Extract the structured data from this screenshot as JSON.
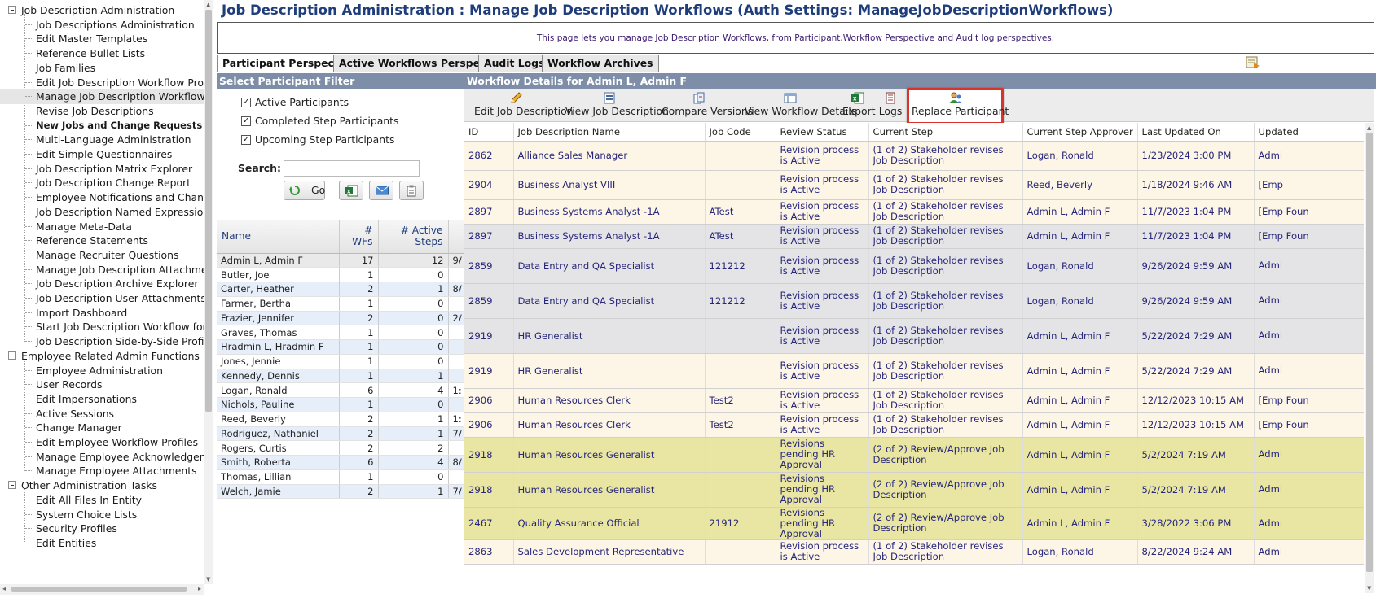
{
  "tree": {
    "groups": [
      {
        "label": "Job Description Administration",
        "items": [
          {
            "label": "Job Descriptions Administration"
          },
          {
            "label": "Edit Master Templates"
          },
          {
            "label": "Reference Bullet Lists"
          },
          {
            "label": "Job Families"
          },
          {
            "label": "Edit Job Description Workflow Prof"
          },
          {
            "label": "Manage Job Description Workflows",
            "selected": true
          },
          {
            "label": "Revise Job Descriptions"
          },
          {
            "label": "New Jobs and Change Requests Admin",
            "bold": true
          },
          {
            "label": "Multi-Language Administration"
          },
          {
            "label": "Edit Simple Questionnaires"
          },
          {
            "label": "Job Description Matrix Explorer"
          },
          {
            "label": "Job Description Change Report"
          },
          {
            "label": "Employee Notifications and Chang"
          },
          {
            "label": "Job Description Named Expression"
          },
          {
            "label": "Manage Meta-Data"
          },
          {
            "label": "Reference Statements"
          },
          {
            "label": "Manage Recruiter Questions"
          },
          {
            "label": "Manage Job Description Attachme"
          },
          {
            "label": "Job Description Archive Explorer"
          },
          {
            "label": "Job Description User Attachments"
          },
          {
            "label": "Import Dashboard"
          },
          {
            "label": "Start Job Description Workflow for"
          },
          {
            "label": "Job Description Side-by-Side Profi"
          }
        ]
      },
      {
        "label": "Employee Related Admin Functions",
        "items": [
          {
            "label": "Employee Administration"
          },
          {
            "label": "User Records"
          },
          {
            "label": "Edit Impersonations"
          },
          {
            "label": "Active Sessions"
          },
          {
            "label": "Change Manager"
          },
          {
            "label": "Edit Employee Workflow Profiles"
          },
          {
            "label": "Manage Employee Acknowledgem"
          },
          {
            "label": "Manage Employee Attachments"
          }
        ]
      },
      {
        "label": "Other Administration Tasks",
        "items": [
          {
            "label": "Edit All Files In Entity"
          },
          {
            "label": "System Choice Lists"
          },
          {
            "label": "Security Profiles"
          },
          {
            "label": "Edit Entities"
          }
        ]
      }
    ]
  },
  "header": {
    "title": "Job Description Administration : Manage Job Description Workflows (Auth Settings: ManageJobDescriptionWorkflows)",
    "info": "This page lets you manage Job Description Workflows, from Participant,Workflow Perspective and Audit log perspectives."
  },
  "tabs": [
    {
      "label": "Participant Perspective",
      "active": true
    },
    {
      "label": "Active Workflows Perspective"
    },
    {
      "label": "Audit Logs"
    },
    {
      "label": "Workflow Archives"
    }
  ],
  "filter": {
    "heading": "Select Participant Filter",
    "checkboxes": [
      {
        "label": "Active Participants",
        "checked": true
      },
      {
        "label": "Completed Step Participants",
        "checked": true
      },
      {
        "label": "Upcoming Step Participants",
        "checked": true
      }
    ],
    "search_label": "Search:",
    "search_value": "",
    "go_label": "Go"
  },
  "participants": {
    "columns": [
      "Name",
      "# WFs",
      "# Active Steps",
      ""
    ],
    "rows": [
      {
        "name": "Admin L, Admin F",
        "wfs": "17",
        "active": "12",
        "extra": "9/",
        "selected": true
      },
      {
        "name": "Butler, Joe",
        "wfs": "1",
        "active": "0",
        "extra": ""
      },
      {
        "name": "Carter, Heather",
        "wfs": "2",
        "active": "1",
        "extra": "8/"
      },
      {
        "name": "Farmer, Bertha",
        "wfs": "1",
        "active": "0",
        "extra": ""
      },
      {
        "name": "Frazier, Jennifer",
        "wfs": "2",
        "active": "0",
        "extra": "2/"
      },
      {
        "name": "Graves, Thomas",
        "wfs": "1",
        "active": "0",
        "extra": ""
      },
      {
        "name": "Hradmin L, Hradmin F",
        "wfs": "1",
        "active": "0",
        "extra": ""
      },
      {
        "name": "Jones, Jennie",
        "wfs": "1",
        "active": "0",
        "extra": ""
      },
      {
        "name": "Kennedy, Dennis",
        "wfs": "1",
        "active": "1",
        "extra": ""
      },
      {
        "name": "Logan, Ronald",
        "wfs": "6",
        "active": "4",
        "extra": "1:"
      },
      {
        "name": "Nichols, Pauline",
        "wfs": "1",
        "active": "0",
        "extra": ""
      },
      {
        "name": "Reed, Beverly",
        "wfs": "2",
        "active": "1",
        "extra": "1:"
      },
      {
        "name": "Rodriguez, Nathaniel",
        "wfs": "2",
        "active": "1",
        "extra": "7/"
      },
      {
        "name": "Rogers, Curtis",
        "wfs": "2",
        "active": "2",
        "extra": ""
      },
      {
        "name": "Smith, Roberta",
        "wfs": "6",
        "active": "4",
        "extra": "8/"
      },
      {
        "name": "Thomas, Lillian",
        "wfs": "1",
        "active": "0",
        "extra": ""
      },
      {
        "name": "Welch, Jamie",
        "wfs": "2",
        "active": "1",
        "extra": "7/"
      }
    ]
  },
  "workflow": {
    "heading": "Workflow Details for Admin L, Admin F",
    "toolbar": [
      {
        "label": "Edit Job Description",
        "icon": "pencil-icon"
      },
      {
        "label": "View Job Description",
        "icon": "document-view-icon"
      },
      {
        "label": "Compare Versions",
        "icon": "compare-icon"
      },
      {
        "label": "View Workflow Details",
        "icon": "workflow-icon"
      },
      {
        "label": "Export",
        "icon": "excel-export-icon"
      },
      {
        "label": "Logs",
        "icon": "logs-icon"
      },
      {
        "label": "Replace Participant",
        "icon": "replace-user-icon",
        "highlighted": true
      }
    ],
    "columns": [
      "ID",
      "Job Description Name",
      "Job Code",
      "Review Status",
      "Current Step",
      "Current Step Approver",
      "Last Updated On",
      "Updated"
    ],
    "rows": [
      {
        "id": "2862",
        "name": "Alliance Sales Manager",
        "code": "",
        "status": "Revision process is Active",
        "step": "(1 of 2) Stakeholder revises Job Description",
        "approver": "Logan, Ronald",
        "updated_on": "1/23/2024 3:00 PM",
        "updated_by": "Admi",
        "color": "cream"
      },
      {
        "id": "2904",
        "name": "Business Analyst VIII",
        "code": "",
        "status": "Revision process is Active",
        "step": "(1 of 2) Stakeholder revises Job Description",
        "approver": "Reed, Beverly",
        "updated_on": "1/18/2024 9:46 AM",
        "updated_by": "[Emp",
        "color": "cream"
      },
      {
        "id": "2897",
        "name": "Business Systems Analyst -1A",
        "code": "ATest",
        "status": "Revision process is Active",
        "step": "(1 of 2) Stakeholder revises Job Description",
        "approver": "Admin L, Admin F",
        "updated_on": "11/7/2023 1:04 PM",
        "updated_by": "[Emp Foun",
        "color": "cream"
      },
      {
        "id": "2897",
        "name": "Business Systems Analyst -1A",
        "code": "ATest",
        "status": "Revision process is Active",
        "step": "(1 of 2) Stakeholder revises Job Description",
        "approver": "Admin L, Admin F",
        "updated_on": "11/7/2023 1:04 PM",
        "updated_by": "[Emp Foun",
        "color": "grey"
      },
      {
        "id": "2859",
        "name": "Data Entry and QA Specialist",
        "code": "121212",
        "status": "Revision process is Active",
        "step": "(1 of 2) Stakeholder revises Job Description",
        "approver": "Logan, Ronald",
        "updated_on": "9/26/2024 9:59 AM",
        "updated_by": "Admi",
        "color": "grey"
      },
      {
        "id": "2859",
        "name": "Data Entry and QA Specialist",
        "code": "121212",
        "status": "Revision process is Active",
        "step": "(1 of 2) Stakeholder revises Job Description",
        "approver": "Logan, Ronald",
        "updated_on": "9/26/2024 9:59 AM",
        "updated_by": "Admi",
        "color": "grey"
      },
      {
        "id": "2919",
        "name": "HR Generalist",
        "code": "",
        "status": "Revision process is Active",
        "step": "(1 of 2) Stakeholder revises Job Description",
        "approver": "Admin L, Admin F",
        "updated_on": "5/22/2024 7:29 AM",
        "updated_by": "Admi",
        "color": "grey"
      },
      {
        "id": "2919",
        "name": "HR Generalist",
        "code": "",
        "status": "Revision process is Active",
        "step": "(1 of 2) Stakeholder revises Job Description",
        "approver": "Admin L, Admin F",
        "updated_on": "5/22/2024 7:29 AM",
        "updated_by": "Admi",
        "color": "cream"
      },
      {
        "id": "2906",
        "name": "Human Resources Clerk",
        "code": "Test2",
        "status": "Revision process is Active",
        "step": "(1 of 2) Stakeholder revises Job Description",
        "approver": "Admin L, Admin F",
        "updated_on": "12/12/2023 10:15 AM",
        "updated_by": "[Emp Foun",
        "color": "cream"
      },
      {
        "id": "2906",
        "name": "Human Resources Clerk",
        "code": "Test2",
        "status": "Revision process is Active",
        "step": "(1 of 2) Stakeholder revises Job Description",
        "approver": "Admin L, Admin F",
        "updated_on": "12/12/2023 10:15 AM",
        "updated_by": "[Emp Foun",
        "color": "cream"
      },
      {
        "id": "2918",
        "name": "Human Resources Generalist",
        "code": "",
        "status": "Revisions pending HR Approval",
        "step": "(2 of 2) Review/Approve Job Description",
        "approver": "Admin L, Admin F",
        "updated_on": "5/2/2024 7:19 AM",
        "updated_by": "Admi",
        "color": "olive"
      },
      {
        "id": "2918",
        "name": "Human Resources Generalist",
        "code": "",
        "status": "Revisions pending HR Approval",
        "step": "(2 of 2) Review/Approve Job Description",
        "approver": "Admin L, Admin F",
        "updated_on": "5/2/2024 7:19 AM",
        "updated_by": "Admi",
        "color": "olive"
      },
      {
        "id": "2467",
        "name": "Quality Assurance Official",
        "code": "21912",
        "status": "Revisions pending HR Approval",
        "step": "(2 of 2) Review/Approve Job Description",
        "approver": "Admin L, Admin F",
        "updated_on": "3/28/2022 3:06 PM",
        "updated_by": "Admi",
        "color": "olive"
      },
      {
        "id": "2863",
        "name": "Sales Development Representative",
        "code": "",
        "status": "Revision process is Active",
        "step": "(1 of 2) Stakeholder revises Job Description",
        "approver": "Logan, Ronald",
        "updated_on": "8/22/2024 9:24 AM",
        "updated_by": "Admi",
        "color": "cream"
      }
    ]
  },
  "colors": {
    "title": "#1f3d7a",
    "panel_header": "#7e8ea8",
    "highlight": "#d9342b",
    "row_cream": "#fdf5e6",
    "row_grey": "#e4e4e6",
    "row_olive": "#e9e6a3"
  }
}
